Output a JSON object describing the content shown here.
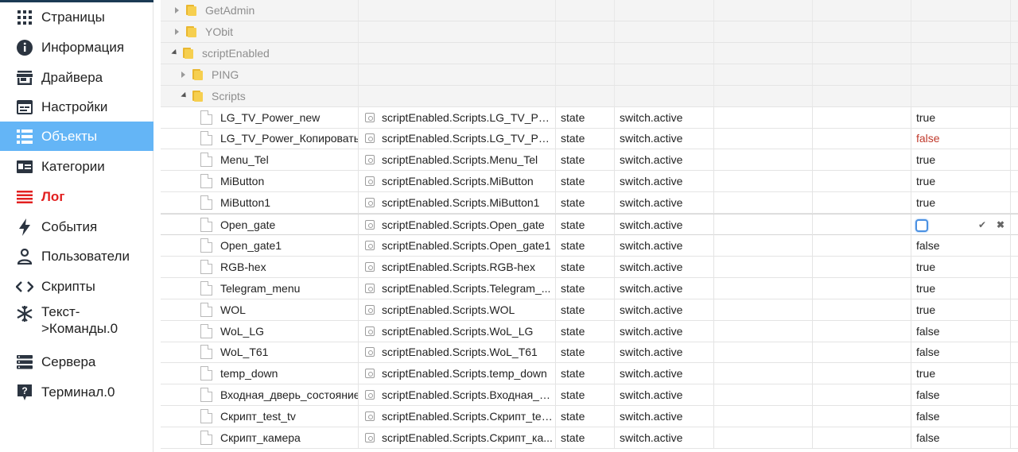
{
  "sidebar": {
    "items": [
      {
        "label": "Страницы",
        "icon": "apps-grid-icon"
      },
      {
        "label": "Информация",
        "icon": "info-icon"
      },
      {
        "label": "Драйвера",
        "icon": "store-icon"
      },
      {
        "label": "Настройки",
        "icon": "settings-panel-icon"
      },
      {
        "label": "Объекты",
        "icon": "list-icon"
      },
      {
        "label": "Категории",
        "icon": "category-icon"
      },
      {
        "label": "Лог",
        "icon": "log-icon"
      },
      {
        "label": "События",
        "icon": "lightning-icon"
      },
      {
        "label": "Пользователи",
        "icon": "user-icon"
      },
      {
        "label": "Скрипты",
        "icon": "code-icon"
      },
      {
        "label": "Текст-\n>Команды.0",
        "icon": "snowflake-icon"
      },
      {
        "label": "Сервера",
        "icon": "servers-icon"
      },
      {
        "label": "Терминал.0",
        "icon": "help-icon"
      }
    ],
    "active_label": "Объекты",
    "colors": {
      "active_bg": "#64b5f6",
      "log_color": "#e22020"
    }
  },
  "tree": {
    "folders": [
      {
        "label": "GetAdmin"
      },
      {
        "label": "YObit"
      },
      {
        "label": "scriptEnabled"
      },
      {
        "label": "PING"
      },
      {
        "label": "Scripts"
      }
    ],
    "objects": [
      {
        "name": "LG_TV_Power_new",
        "id": "scriptEnabled.Scripts.LG_TV_Pow...",
        "type": "state",
        "role": "switch.active",
        "value": "true"
      },
      {
        "name": "LG_TV_Power_Копировать",
        "id": "scriptEnabled.Scripts.LG_TV_Pow...",
        "type": "state",
        "role": "switch.active",
        "value": "false"
      },
      {
        "name": "Menu_Tel",
        "id": "scriptEnabled.Scripts.Menu_Tel",
        "type": "state",
        "role": "switch.active",
        "value": "true"
      },
      {
        "name": "MiButton",
        "id": "scriptEnabled.Scripts.MiButton",
        "type": "state",
        "role": "switch.active",
        "value": "true"
      },
      {
        "name": "MiButton1",
        "id": "scriptEnabled.Scripts.MiButton1",
        "type": "state",
        "role": "switch.active",
        "value": "true"
      },
      {
        "name": "Open_gate",
        "id": "scriptEnabled.Scripts.Open_gate",
        "type": "state",
        "role": "switch.active",
        "value": ""
      },
      {
        "name": "Open_gate1",
        "id": "scriptEnabled.Scripts.Open_gate1",
        "type": "state",
        "role": "switch.active",
        "value": "false"
      },
      {
        "name": "RGB-hex",
        "id": "scriptEnabled.Scripts.RGB-hex",
        "type": "state",
        "role": "switch.active",
        "value": "true"
      },
      {
        "name": "Telegram_menu",
        "id": "scriptEnabled.Scripts.Telegram_...",
        "type": "state",
        "role": "switch.active",
        "value": "true"
      },
      {
        "name": "WOL",
        "id": "scriptEnabled.Scripts.WOL",
        "type": "state",
        "role": "switch.active",
        "value": "true"
      },
      {
        "name": "WoL_LG",
        "id": "scriptEnabled.Scripts.WoL_LG",
        "type": "state",
        "role": "switch.active",
        "value": "false"
      },
      {
        "name": "WoL_T61",
        "id": "scriptEnabled.Scripts.WoL_T61",
        "type": "state",
        "role": "switch.active",
        "value": "false"
      },
      {
        "name": "temp_down",
        "id": "scriptEnabled.Scripts.temp_down",
        "type": "state",
        "role": "switch.active",
        "value": "true"
      },
      {
        "name": "Входная_дверь_состояние",
        "id": "scriptEnabled.Scripts.Входная_д...",
        "type": "state",
        "role": "switch.active",
        "value": "false"
      },
      {
        "name": "Скрипт_test_tv",
        "id": "scriptEnabled.Scripts.Скрипт_tes...",
        "type": "state",
        "role": "switch.active",
        "value": "false"
      },
      {
        "name": "Скрипт_камера",
        "id": "scriptEnabled.Scripts.Скрипт_ка...",
        "type": "state",
        "role": "switch.active",
        "value": "false"
      }
    ],
    "editing": {
      "ok_glyph": "✔",
      "cancel_glyph": "✖"
    }
  }
}
